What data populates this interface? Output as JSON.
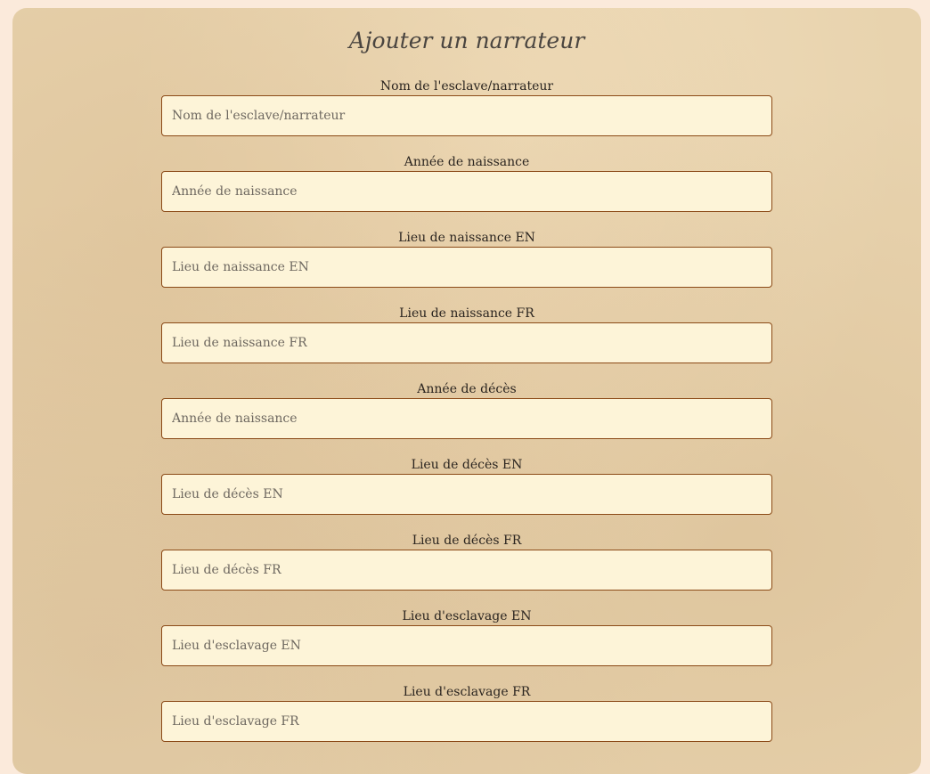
{
  "form": {
    "title": "Ajouter un narrateur",
    "fields": [
      {
        "label": "Nom de l'esclave/narrateur",
        "placeholder": "Nom de l'esclave/narrateur",
        "value": ""
      },
      {
        "label": "Année de naissance",
        "placeholder": "Année de naissance",
        "value": ""
      },
      {
        "label": "Lieu de naissance EN",
        "placeholder": "Lieu de naissance EN",
        "value": ""
      },
      {
        "label": "Lieu de naissance FR",
        "placeholder": "Lieu de naissance FR",
        "value": ""
      },
      {
        "label": "Année de décès",
        "placeholder": "Année de naissance",
        "value": ""
      },
      {
        "label": "Lieu de décès EN",
        "placeholder": "Lieu de décès EN",
        "value": ""
      },
      {
        "label": "Lieu de décès FR",
        "placeholder": "Lieu de décès FR",
        "value": ""
      },
      {
        "label": "Lieu d'esclavage EN",
        "placeholder": "Lieu d'esclavage EN",
        "value": ""
      },
      {
        "label": "Lieu d'esclavage FR",
        "placeholder": "Lieu d'esclavage FR",
        "value": ""
      }
    ]
  },
  "colors": {
    "page_background": "#fbeadb",
    "panel_background": "#e8d3ae",
    "input_background": "#fdf4d8",
    "input_border": "#8b4a17",
    "title_color": "#4a4540",
    "label_color": "#2b2520"
  }
}
